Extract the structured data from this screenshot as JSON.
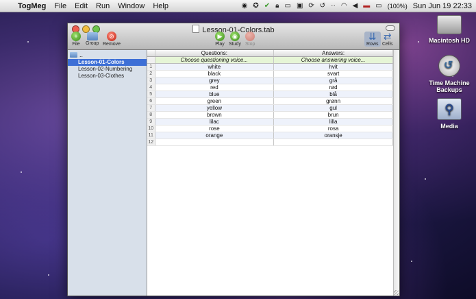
{
  "menubar": {
    "app_name": "TogMeg",
    "menus": [
      "File",
      "Edit",
      "Run",
      "Window",
      "Help"
    ],
    "battery_text": "(100%)",
    "clock": "Sun Jun 19  22:33"
  },
  "desktop": {
    "icons": [
      {
        "label": "Macintosh HD",
        "icon": "hard-drive-icon"
      },
      {
        "label": "Time Machine Backups",
        "icon": "time-machine-icon"
      },
      {
        "label": "Media",
        "icon": "drive-icon"
      }
    ]
  },
  "window": {
    "title": "Lesson-01-Colors.tab",
    "toolbar": {
      "file": "File",
      "group": "Group",
      "remove": "Remove",
      "play": "Play",
      "study": "Study",
      "stop": "Stop",
      "rows": "Rows",
      "cells": "Cells"
    },
    "sidebar": {
      "root": "..",
      "items": [
        "Lesson-01-Colors",
        "Lesson-02-Numbering",
        "Lesson-03-Clothes"
      ],
      "selected_index": 0
    },
    "table": {
      "headers": [
        "Questions:",
        "Answers:"
      ],
      "voice_row": [
        "Choose questioning voice...",
        "Choose answering voice..."
      ],
      "rows": [
        {
          "n": "1",
          "q": "white",
          "a": "hvit"
        },
        {
          "n": "2",
          "q": "black",
          "a": "svart"
        },
        {
          "n": "3",
          "q": "grey",
          "a": "grå"
        },
        {
          "n": "4",
          "q": "red",
          "a": "rød"
        },
        {
          "n": "5",
          "q": "blue",
          "a": "blå"
        },
        {
          "n": "6",
          "q": "green",
          "a": "grønn"
        },
        {
          "n": "7",
          "q": "yellow",
          "a": "gul"
        },
        {
          "n": "8",
          "q": "brown",
          "a": "brun"
        },
        {
          "n": "9",
          "q": "lilac",
          "a": "lilla"
        },
        {
          "n": "10",
          "q": "rose",
          "a": "rosa"
        },
        {
          "n": "11",
          "q": "orange",
          "a": "oransje"
        },
        {
          "n": "12",
          "q": "",
          "a": ""
        }
      ]
    }
  }
}
